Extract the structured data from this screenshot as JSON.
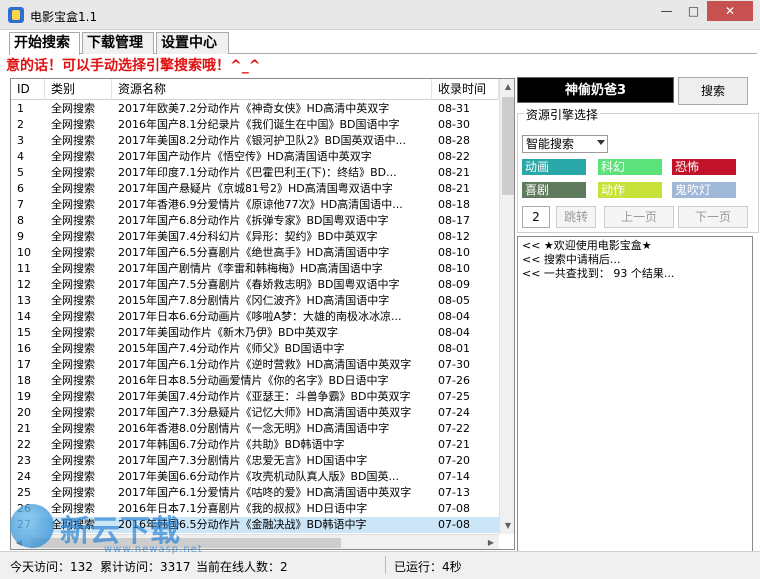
{
  "window": {
    "title": "电影宝盒1.1",
    "min_label": "—",
    "max_label": "□",
    "close_label": "✕"
  },
  "tabs": [
    "开始搜索",
    "下载管理",
    "设置中心"
  ],
  "marquee": "意的话！可以手动选择引擎搜索哦！^_^",
  "table": {
    "headers": [
      "ID",
      "类别",
      "资源名称",
      "收录时间"
    ],
    "rows": [
      [
        "1",
        "全网搜索",
        "2017年欧美7.2分动作片《神奇女侠》HD高清中英双字",
        "08-31"
      ],
      [
        "2",
        "全网搜索",
        "2016年国产8.1分纪录片《我们诞生在中国》BD国语中字",
        "08-30"
      ],
      [
        "3",
        "全网搜索",
        "2017年美国8.2分动作片《银河护卫队2》BD国英双语中...",
        "08-28"
      ],
      [
        "4",
        "全网搜索",
        "2017年国产动作片《悟空传》HD高清国语中英双字",
        "08-22"
      ],
      [
        "5",
        "全网搜索",
        "2017年印度7.1分动作片《巴霍巴利王(下)：终结》BD...",
        "08-21"
      ],
      [
        "6",
        "全网搜索",
        "2017年国产悬疑片《京城81号2》HD高清国粤双语中字",
        "08-21"
      ],
      [
        "7",
        "全网搜索",
        "2017年香港6.9分爱情片《原谅他77次》HD高清国语中...",
        "08-18"
      ],
      [
        "8",
        "全网搜索",
        "2017年国产6.8分动作片《拆弹专家》BD国粤双语中字",
        "08-17"
      ],
      [
        "9",
        "全网搜索",
        "2017年美国7.4分科幻片《异形：契约》BD中英双字",
        "08-12"
      ],
      [
        "10",
        "全网搜索",
        "2017年国产6.5分喜剧片《绝世高手》HD高清国语中字",
        "08-10"
      ],
      [
        "11",
        "全网搜索",
        "2017年国产剧情片《李雷和韩梅梅》HD高清国语中字",
        "08-10"
      ],
      [
        "12",
        "全网搜索",
        "2017年国产7.5分喜剧片《春娇救志明》BD国粤双语中字",
        "08-09"
      ],
      [
        "13",
        "全网搜索",
        "2015年国产7.8分剧情片《冈仁波齐》HD高清国语中字",
        "08-05"
      ],
      [
        "14",
        "全网搜索",
        "2017年日本6.6分动画片《哆啦A梦：大雄的南极冰冰凉...",
        "08-04"
      ],
      [
        "15",
        "全网搜索",
        "2017年美国动作片《新木乃伊》BD中英双字",
        "08-04"
      ],
      [
        "16",
        "全网搜索",
        "2015年国产7.4分动作片《师父》BD国语中字",
        "08-01"
      ],
      [
        "17",
        "全网搜索",
        "2017年国产6.1分动作片《逆时营救》HD高清国语中英双字",
        "07-30"
      ],
      [
        "18",
        "全网搜索",
        "2016年日本8.5分动画爱情片《你的名字》BD日语中字",
        "07-26"
      ],
      [
        "19",
        "全网搜索",
        "2017年美国7.4分动作片《亚瑟王：斗兽争霸》BD中英双字",
        "07-25"
      ],
      [
        "20",
        "全网搜索",
        "2017年国产7.3分悬疑片《记忆大师》HD高清国语中英双字",
        "07-24"
      ],
      [
        "21",
        "全网搜索",
        "2016年香港8.0分剧情片《一念无明》HD高清国语中字",
        "07-22"
      ],
      [
        "22",
        "全网搜索",
        "2017年韩国6.7分动作片《共助》BD韩语中字",
        "07-21"
      ],
      [
        "23",
        "全网搜索",
        "2017年国产7.3分剧情片《忠爱无言》HD国语中字",
        "07-20"
      ],
      [
        "24",
        "全网搜索",
        "2017年美国6.6分动作片《攻壳机动队真人版》BD国英...",
        "07-14"
      ],
      [
        "25",
        "全网搜索",
        "2017年国产6.1分爱情片《咕咚的爱》HD高清国语中英双字",
        "07-13"
      ],
      [
        "26",
        "全网搜索",
        "2016年日本7.1分喜剧片《我的叔叔》HD日语中字",
        "07-08"
      ],
      [
        "27",
        "全网搜索",
        "2016年韩国6.5分动作片《金融决战》BD韩语中字",
        "07-08"
      ]
    ]
  },
  "right": {
    "user": "神偷奶爸3",
    "search_button": "搜索",
    "group_title": "资源引擎选择",
    "engine_selected": "智能搜索",
    "genres": [
      {
        "label": "动画",
        "color": "#2aa8a8"
      },
      {
        "label": "科幻",
        "color": "#5ce27a"
      },
      {
        "label": "恐怖",
        "color": "#c2122a"
      },
      {
        "label": "喜剧",
        "color": "#5f7a5c"
      },
      {
        "label": "动作",
        "color": "#c8e23a"
      },
      {
        "label": "鬼吹灯",
        "color": "#9fb8d8"
      }
    ],
    "page_number": "2",
    "jump": "跳转",
    "prev": "上一页",
    "next": "下一页",
    "log": [
      "<<  ★欢迎使用电影宝盒★",
      "<<  搜索中请稍后...",
      "<<  一共查找到： 93 个结果..."
    ]
  },
  "status": {
    "today": "今天访问：132",
    "total": "累计访问：3317",
    "online": "当前在线人数：2",
    "runtime": "已运行：4秒"
  },
  "watermark": {
    "brand": "新云下载",
    "url": "www.newasp.net"
  }
}
